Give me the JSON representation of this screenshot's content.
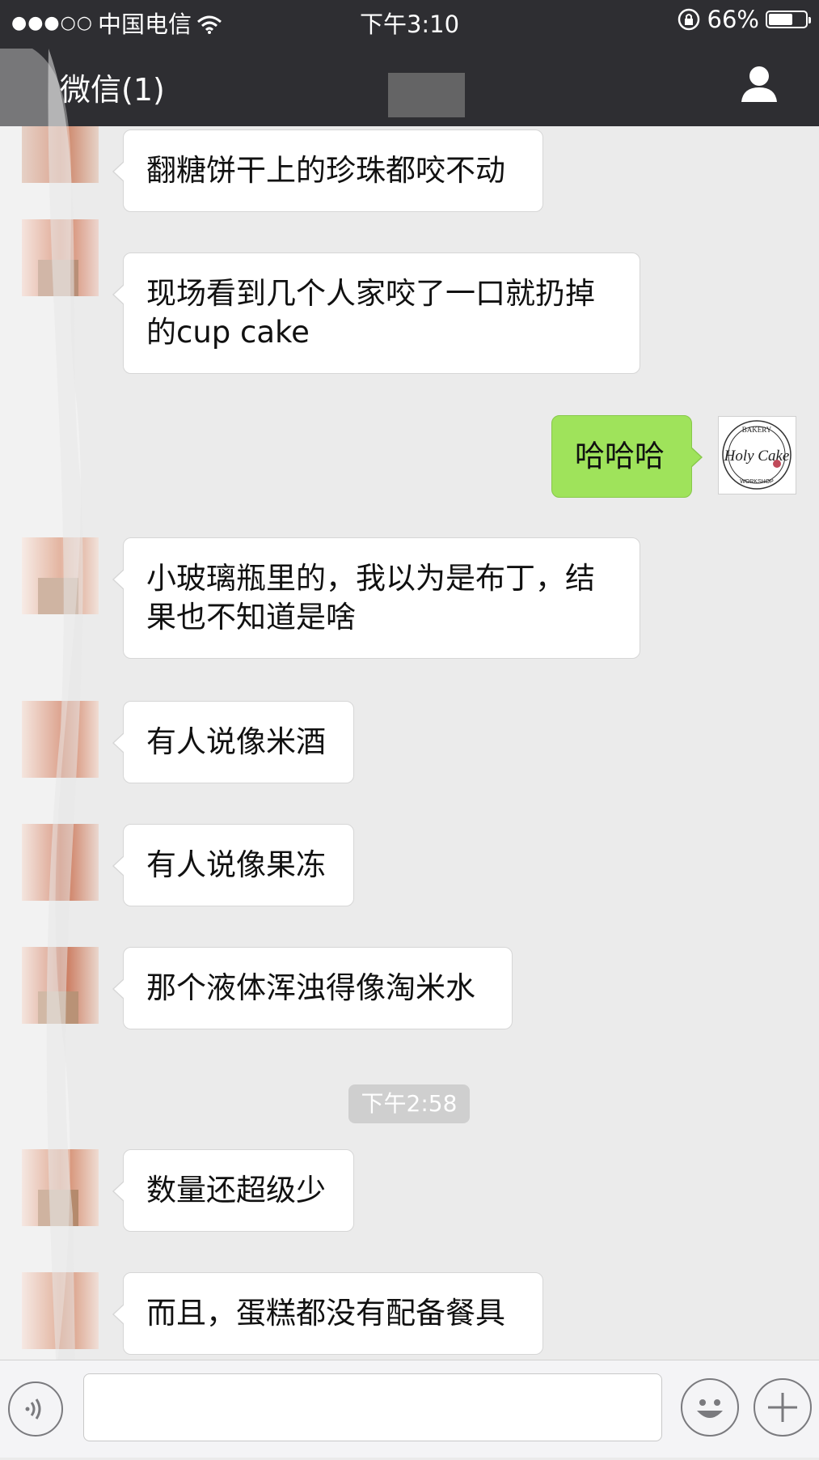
{
  "status_bar": {
    "signal": "●●●○○",
    "carrier": "中国电信",
    "time": "下午3:10",
    "battery": "66%",
    "battery_level": 0.66
  },
  "nav": {
    "back_title": "微信(1)"
  },
  "messages": [
    {
      "side": "in",
      "text": "翻糖饼干上的珍珠都咬不动"
    },
    {
      "side": "in",
      "text": "现场看到几个人家咬了一口就扔掉的cup cake"
    },
    {
      "side": "out",
      "text": "哈哈哈"
    },
    {
      "side": "in",
      "text": "小玻璃瓶里的，我以为是布丁，结果也不知道是啥"
    },
    {
      "side": "in",
      "text": "有人说像米酒"
    },
    {
      "side": "in",
      "text": "有人说像果冻"
    },
    {
      "side": "in",
      "text": "那个液体浑浊得像淘米水"
    },
    {
      "side": "time",
      "text": "下午2:58"
    },
    {
      "side": "in",
      "text": "数量还超级少"
    },
    {
      "side": "in",
      "text": "而且，蛋糕都没有配备餐具"
    }
  ],
  "my_avatar_logo": {
    "top_text": "BAKERY",
    "main_text": "Holy Cake",
    "bottom_text": "WORKSHOP"
  },
  "icons": {
    "wifi": "wifi-icon",
    "lock": "rotation-lock-icon",
    "profile": "person-icon",
    "voice": "voice-icon",
    "emoji": "emoji-icon",
    "plus": "plus-icon"
  },
  "colors": {
    "bar_bg": "#2e2e32",
    "chat_bg": "#ebebeb",
    "outgoing_bubble": "#9fe35b",
    "incoming_bubble": "#ffffff"
  }
}
